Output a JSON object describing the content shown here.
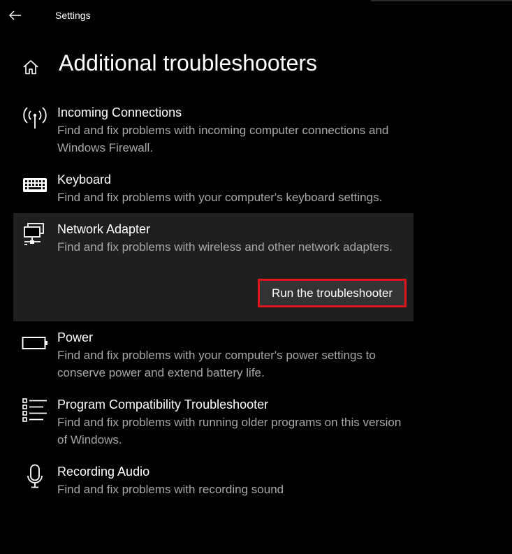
{
  "window": {
    "app_title": "Settings"
  },
  "header": {
    "title": "Additional troubleshooters"
  },
  "items": [
    {
      "icon": "antenna-icon",
      "title": "Incoming Connections",
      "description": "Find and fix problems with incoming computer connections and Windows Firewall."
    },
    {
      "icon": "keyboard-icon",
      "title": "Keyboard",
      "description": "Find and fix problems with your computer's keyboard settings."
    },
    {
      "icon": "network-adapter-icon",
      "title": "Network Adapter",
      "description": "Find and fix problems with wireless and other network adapters.",
      "selected": true,
      "button_label": "Run the troubleshooter"
    },
    {
      "icon": "battery-icon",
      "title": "Power",
      "description": "Find and fix problems with your computer's power settings to conserve power and extend battery life."
    },
    {
      "icon": "program-list-icon",
      "title": "Program Compatibility Troubleshooter",
      "description": "Find and fix problems with running older programs on this version of Windows."
    },
    {
      "icon": "microphone-icon",
      "title": "Recording Audio",
      "description": "Find and fix problems with recording sound"
    }
  ],
  "colors": {
    "background": "#000000",
    "selected_background": "#1f1f1f",
    "description_text": "#a8a8a8",
    "highlight_border": "#e0161f",
    "button_background": "#333333"
  }
}
